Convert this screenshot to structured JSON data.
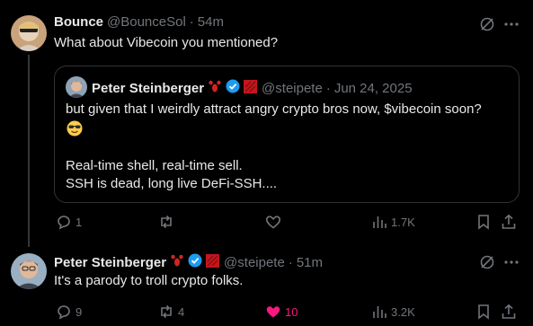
{
  "post1": {
    "name": "Bounce",
    "handle": "@BounceSol",
    "sep": "·",
    "time": "54m",
    "text": "What about Vibecoin you mentioned?",
    "quote": {
      "name": "Peter Steinberger",
      "handle": "@steipete",
      "sep": "·",
      "date": "Jun 24, 2025",
      "line1": "but given that I weirdly attract angry crypto bros now, $vibecoin soon?",
      "line2": "Real-time shell, real-time sell.",
      "line3": "SSH is dead, long live DeFi-SSH...."
    },
    "actions": {
      "replies": "1",
      "reposts": "",
      "likes": "",
      "views": "1.7K"
    }
  },
  "post2": {
    "name": "Peter Steinberger",
    "handle": "@steipete",
    "sep": "·",
    "time": "51m",
    "text": "It's a parody to troll crypto folks.",
    "actions": {
      "replies": "9",
      "reposts": "4",
      "likes": "10",
      "views": "3.2K"
    }
  },
  "colors": {
    "background": "#000000",
    "text": "#e7e9ea",
    "muted": "#71767b",
    "verified": "#1d9bf0",
    "liked": "#f91880",
    "border": "#2f3336"
  },
  "icons": [
    "grok-icon",
    "more-icon",
    "reply-icon",
    "repost-icon",
    "like-icon",
    "views-icon",
    "bookmark-icon",
    "share-icon",
    "lobster-icon",
    "verified-badge",
    "flag-icon",
    "sunglasses-emoji"
  ]
}
